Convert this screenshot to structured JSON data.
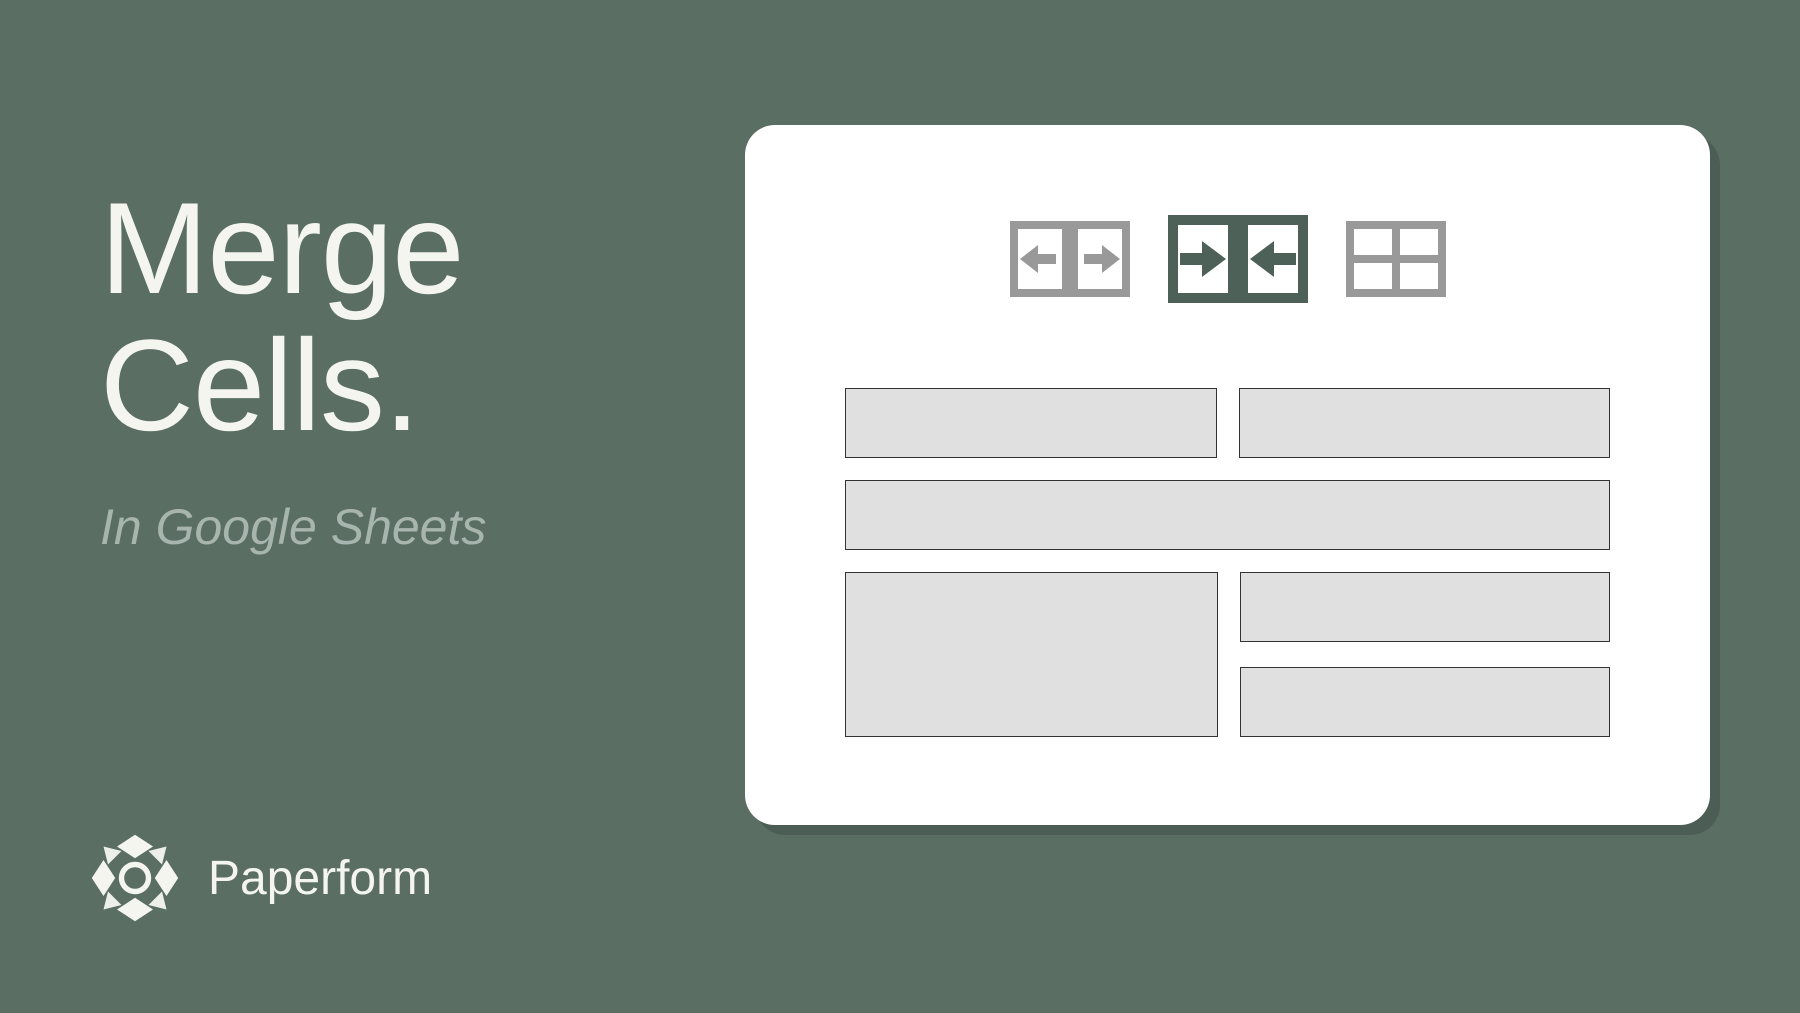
{
  "title_line1": "Merge",
  "title_line2": "Cells.",
  "subtitle": "In Google Sheets",
  "brand": "Paperform",
  "colors": {
    "background": "#5a6e64",
    "text_light": "#f5f5f0",
    "text_muted": "#a8b5ae",
    "card_bg": "#ffffff",
    "cell_fill": "#e0e0e0",
    "icon_gray": "#999999",
    "icon_accent": "#4d6158"
  },
  "toolbar": {
    "unmerge_icon": "unmerge-horizontal-icon",
    "merge_icon": "merge-horizontal-icon",
    "grid_icon": "grid-icon"
  }
}
